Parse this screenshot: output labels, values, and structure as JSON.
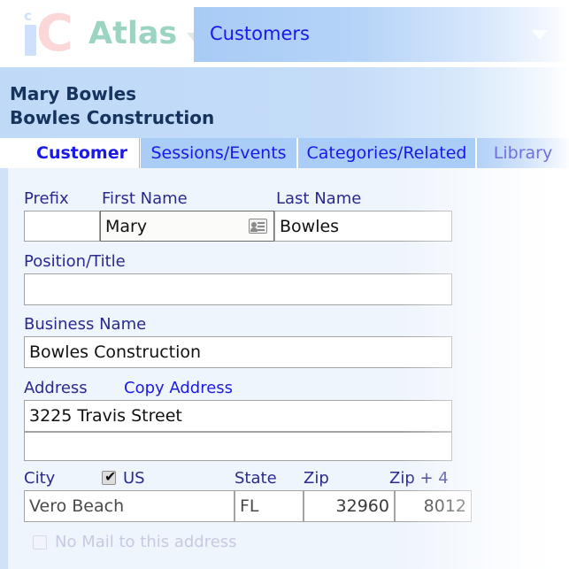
{
  "brand": {
    "logo_i_sup": "c",
    "logo_c": "C",
    "wordmark": "Atlas",
    "wordmark_caret_icon": "chevron-down-icon"
  },
  "module_bar": {
    "selected": "Customers",
    "caret_icon": "chevron-down-icon"
  },
  "record_header": {
    "name": "Mary Bowles",
    "business": "Bowles Construction"
  },
  "tabs": [
    {
      "label": "Customer",
      "active": true
    },
    {
      "label": "Sessions/Events",
      "active": false
    },
    {
      "label": "Categories/Related",
      "active": false
    },
    {
      "label": "Library",
      "active": false
    }
  ],
  "form": {
    "prefix": {
      "label": "Prefix",
      "value": ""
    },
    "first_name": {
      "label": "First Name",
      "value": "Mary",
      "icon": "contact-card-icon"
    },
    "last_name": {
      "label": "Last Name",
      "value": "Bowles"
    },
    "position_title": {
      "label": "Position/Title",
      "value": ""
    },
    "business_name": {
      "label": "Business Name",
      "value": "Bowles Construction"
    },
    "address": {
      "label": "Address",
      "copy_link": "Copy Address",
      "line1": "3225 Travis Street",
      "line2": ""
    },
    "city": {
      "label": "City",
      "value": "Vero Beach"
    },
    "us": {
      "label": "US",
      "checked": true
    },
    "state": {
      "label": "State",
      "value": "FL"
    },
    "zip": {
      "label": "Zip",
      "value": "32960"
    },
    "zip4": {
      "label": "Zip + 4",
      "value": "8012"
    },
    "no_mail": {
      "label": "No Mail to this address",
      "checked": false,
      "disabled": true
    }
  },
  "colors": {
    "brand_teal": "#9bd4c2",
    "logo_pink": "#fbd7d7",
    "logo_blue": "#cfe0fb",
    "tab_blue": "#a9cdf6",
    "link_blue": "#1a19e8",
    "label_navy": "#2a2a8e",
    "header_navy": "#16335e",
    "body_bg": "#eff5fd"
  }
}
